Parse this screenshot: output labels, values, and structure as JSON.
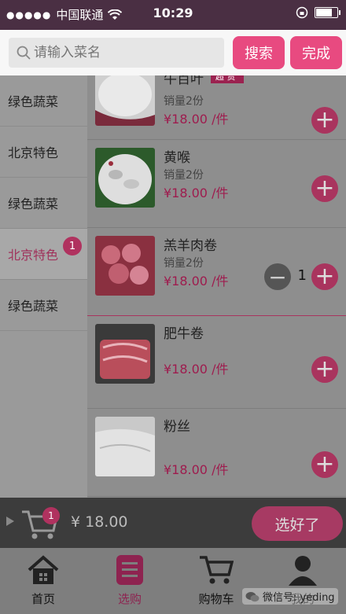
{
  "status": {
    "carrier": "中国联通",
    "time": "10:29"
  },
  "search": {
    "placeholder": "请输入菜名",
    "search_label": "搜索",
    "done_label": "完成"
  },
  "categories": [
    {
      "label": "绿色蔬菜"
    },
    {
      "label": "北京特色"
    },
    {
      "label": "绿色蔬菜"
    },
    {
      "label": "北京特色",
      "badge": "1"
    },
    {
      "label": "绿色蔬菜"
    }
  ],
  "items": [
    {
      "name": "牛百叶",
      "tag": "超 贵",
      "sales": "销量2份",
      "price": "¥18.00 /件"
    },
    {
      "name": "黄喉",
      "sales": "销量2份",
      "price": "¥18.00 /件"
    },
    {
      "name": "羔羊肉卷",
      "sales": "销量2份",
      "price": "¥18.00 /件",
      "qty": "1"
    },
    {
      "name": "肥牛卷",
      "price": "¥18.00 /件"
    },
    {
      "name": "粉丝",
      "price": "¥18.00 /件"
    }
  ],
  "cart": {
    "count": "1",
    "total": "¥ 18.00",
    "confirm_label": "选好了"
  },
  "tabs": [
    {
      "label": "首页"
    },
    {
      "label": "选购"
    },
    {
      "label": "购物车"
    },
    {
      "label": "我的"
    }
  ],
  "watermark": "微信号: yeding",
  "colors": {
    "accent": "#e84a80",
    "dim_accent": "#a9345e"
  }
}
